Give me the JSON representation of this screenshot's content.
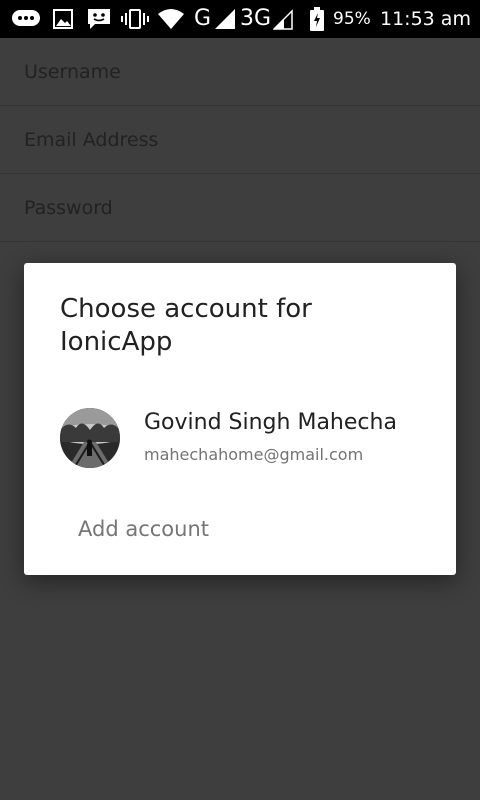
{
  "status_bar": {
    "icons": [
      "messenger-icon",
      "image-icon",
      "sms-icon",
      "vibrate-icon",
      "wifi-icon",
      "signal-icon",
      "signal-icon",
      "battery-charging-icon"
    ],
    "network_1": "G",
    "network_2": "3G",
    "battery": "95%",
    "time": "11:53 am"
  },
  "form": {
    "username_placeholder": "Username",
    "email_placeholder": "Email Address",
    "password_placeholder": "Password"
  },
  "dialog": {
    "title": "Choose account for IonicApp",
    "account": {
      "name": "Govind Singh Mahecha",
      "email": "mahechahome@gmail.com"
    },
    "add_account_label": "Add account"
  },
  "colors": {
    "background": "#3e3e3e",
    "status_bar": "#000000",
    "dialog": "#ffffff",
    "title_text": "#212121",
    "secondary_text": "#737373"
  }
}
